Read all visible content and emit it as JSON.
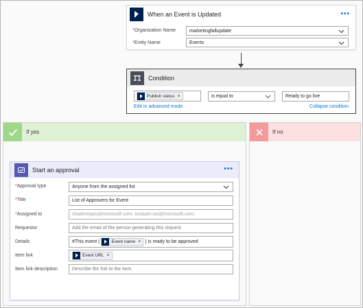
{
  "trigger": {
    "title": "When an Event is Updated",
    "menu": "•••",
    "fields": [
      {
        "label": "Organization Name",
        "required": "*",
        "value": "marketingfallupdate"
      },
      {
        "label": "Entity Name",
        "required": "*",
        "value": "Events"
      }
    ]
  },
  "condition": {
    "title": "Condition",
    "token": "Publish status",
    "operator": "is equal to",
    "value": "Ready to go live",
    "edit_link": "Edit in advanced mode",
    "collapse_link": "Collapse condition"
  },
  "branches": {
    "yes_title": "If yes",
    "no_title": "If no"
  },
  "approval": {
    "title": "Start an approval",
    "menu": "•••",
    "rows": {
      "approval_type": {
        "label": "Approval type",
        "required": "*",
        "value": "Anyone from the assigned list"
      },
      "title": {
        "label": "Title",
        "required": "*",
        "value": "List of Approvers for Event"
      },
      "assigned_to": {
        "label": "Assigned to",
        "required": "*",
        "value": "shaileshjain@microsoft.com; sinauen.wu@microsoft.com;"
      },
      "requestor": {
        "label": "Requestor",
        "placeholder": "Add the email of the person generating this request"
      },
      "details": {
        "label": "Details",
        "prefix": "#This event (",
        "token": "Event name",
        "suffix": ") is ready to be approved"
      },
      "item_link": {
        "label": "Item link",
        "token": "Event URL"
      },
      "item_link_desc": {
        "label": "Item link description",
        "placeholder": "Describe the link to the item"
      }
    }
  },
  "colors": {
    "accent": "#0078d4",
    "dynamics": "#002050",
    "approval": "#5558af",
    "yes": "#9fd88a",
    "no": "#f39a9a"
  }
}
